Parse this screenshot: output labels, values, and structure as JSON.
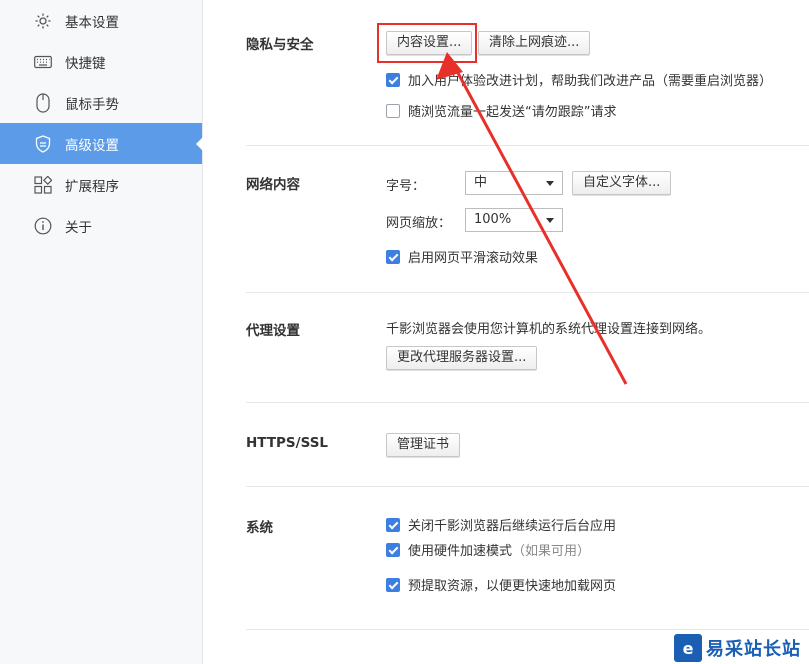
{
  "sidebar": {
    "items": [
      {
        "label": "基本设置",
        "icon": "gear-icon",
        "active": false
      },
      {
        "label": "快捷键",
        "icon": "keyboard-icon",
        "active": false
      },
      {
        "label": "鼠标手势",
        "icon": "mouse-icon",
        "active": false
      },
      {
        "label": "高级设置",
        "icon": "shield-icon",
        "active": true
      },
      {
        "label": "扩展程序",
        "icon": "extensions-icon",
        "active": false
      },
      {
        "label": "关于",
        "icon": "info-icon",
        "active": false
      }
    ]
  },
  "privacy": {
    "title": "隐私与安全",
    "content_settings_label": "内容设置...",
    "clear_traces_label": "清除上网痕迹...",
    "checkbox_ux": "加入用户体验改进计划，帮助我们改进产品（需要重启浏览器）",
    "checkbox_dnt": "随浏览流量一起发送“请勿跟踪”请求"
  },
  "web_content": {
    "title": "网络内容",
    "font_size_label": "字号：",
    "font_size_value": "中",
    "custom_font_label": "自定义字体...",
    "zoom_label": "网页缩放：",
    "zoom_value": "100%",
    "smooth_scroll_label": "启用网页平滑滚动效果"
  },
  "proxy": {
    "title": "代理设置",
    "description": "千影浏览器会使用您计算机的系统代理设置连接到网络。",
    "change_button": "更改代理服务器设置..."
  },
  "https": {
    "title": "HTTPS/SSL",
    "manage_certs": "管理证书"
  },
  "system": {
    "title": "系统",
    "bg_apps": "关闭千影浏览器后继续运行后台应用",
    "hw_accel": "使用硬件加速模式",
    "hw_accel_hint": "（如果可用）",
    "prefetch": "预提取资源，以便更快速地加载网页"
  },
  "watermark": {
    "text": "易采站长站"
  },
  "colors": {
    "accent": "#5b9be7",
    "checkbox": "#3d7fe0",
    "annotation": "#e8302b"
  }
}
